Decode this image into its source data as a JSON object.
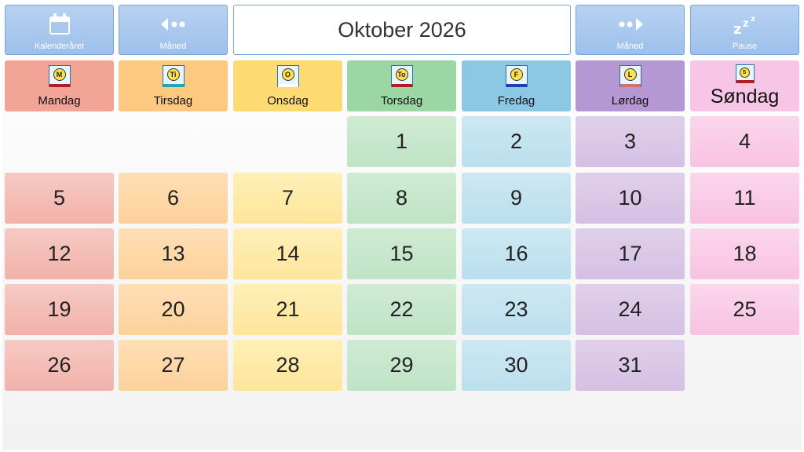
{
  "toolbar": {
    "calendar_year_label": "Kalenderåret",
    "prev_month_label": "Måned",
    "month_title": "Oktober 2026",
    "next_month_label": "Måned",
    "pause_label": "Pause"
  },
  "weekdays": [
    {
      "name": "Mandag",
      "symbol_letter": "M",
      "bar_color": "#b02020",
      "bg": "#f2a497"
    },
    {
      "name": "Tirsdag",
      "symbol_letter": "Ti",
      "bar_color": "#20a8b0",
      "bg": "#fdc980"
    },
    {
      "name": "Onsdag",
      "symbol_letter": "O",
      "bar_color": "#ffffff",
      "bg": "#fddb72"
    },
    {
      "name": "Torsdag",
      "symbol_letter": "To",
      "bar_color": "#b02020",
      "bg": "#9bd7a5"
    },
    {
      "name": "Fredag",
      "symbol_letter": "F",
      "bar_color": "#1f3fb0",
      "bg": "#8cc7e3"
    },
    {
      "name": "Lørdag",
      "symbol_letter": "L",
      "bar_color": "#d07070",
      "bg": "#b598d3"
    },
    {
      "name": "Søndag",
      "symbol_letter": "S",
      "bar_color": "#b02020",
      "bg": "#f7c6e6"
    }
  ],
  "days": [
    "1",
    "2",
    "3",
    "4",
    "5",
    "6",
    "7",
    "8",
    "9",
    "10",
    "11",
    "12",
    "13",
    "14",
    "15",
    "16",
    "17",
    "18",
    "19",
    "20",
    "21",
    "22",
    "23",
    "24",
    "25",
    "26",
    "27",
    "28",
    "29",
    "30",
    "31"
  ],
  "first_weekday_index": 3,
  "colors": {
    "button_top": "#b7d2f2",
    "button_bottom": "#9dc0ea",
    "button_border": "#7aa3d6"
  }
}
